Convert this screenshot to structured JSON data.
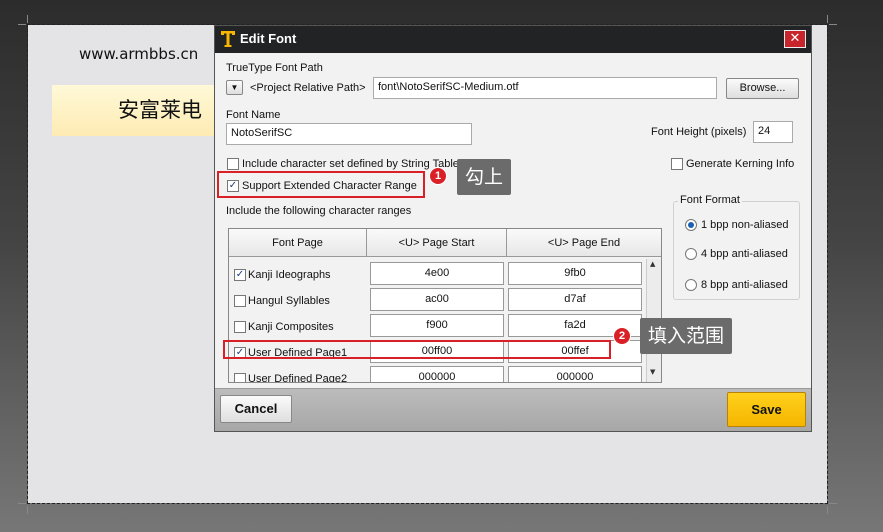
{
  "background": {
    "site_url": "www.armbbs.cn",
    "banner_text": "安富莱电"
  },
  "dialog": {
    "title": "Edit Font",
    "close_glyph": "✕",
    "truetype_label": "TrueType Font Path",
    "path_mode": "<Project Relative Path>",
    "path_value": "font\\NotoSerifSC-Medium.otf",
    "browse_label": "Browse...",
    "font_name_label": "Font Name",
    "font_name_value": "NotoSerifSC",
    "font_height_label": "Font Height (pixels)",
    "font_height_value": "24",
    "include_string_table_label": "Include character set defined by String Table",
    "include_string_table_checked": false,
    "support_extended_label": "Support Extended Character Range",
    "support_extended_checked": true,
    "generate_kerning_label": "Generate Kerning Info",
    "generate_kerning_checked": false,
    "ranges_label": "Include the following character ranges",
    "font_format": {
      "label": "Font Format",
      "options": [
        "1 bpp non-aliased",
        "4 bpp anti-aliased",
        "8 bpp anti-aliased"
      ],
      "selected": "1 bpp non-aliased"
    },
    "table": {
      "headers": [
        "Font Page",
        "<U> Page Start",
        "<U> Page End"
      ],
      "rows": [
        {
          "name": "Kanji Ideographs",
          "checked": true,
          "start": "4e00",
          "end": "9fb0"
        },
        {
          "name": "Hangul Syllables",
          "checked": false,
          "start": "ac00",
          "end": "d7af"
        },
        {
          "name": "Kanji Composites",
          "checked": false,
          "start": "f900",
          "end": "fa2d"
        },
        {
          "name": "User Defined Page1",
          "checked": true,
          "start": "00ff00",
          "end": "00ffef"
        },
        {
          "name": "User Defined Page2",
          "checked": false,
          "start": "000000",
          "end": "000000"
        }
      ]
    },
    "cancel_label": "Cancel",
    "save_label": "Save"
  },
  "annotations": [
    {
      "number": "1",
      "text": "勾上"
    },
    {
      "number": "2",
      "text": "填入范围"
    }
  ],
  "colors": {
    "highlight": "#d92027",
    "save_button": "#f5b500",
    "titlebar": "#222325"
  }
}
